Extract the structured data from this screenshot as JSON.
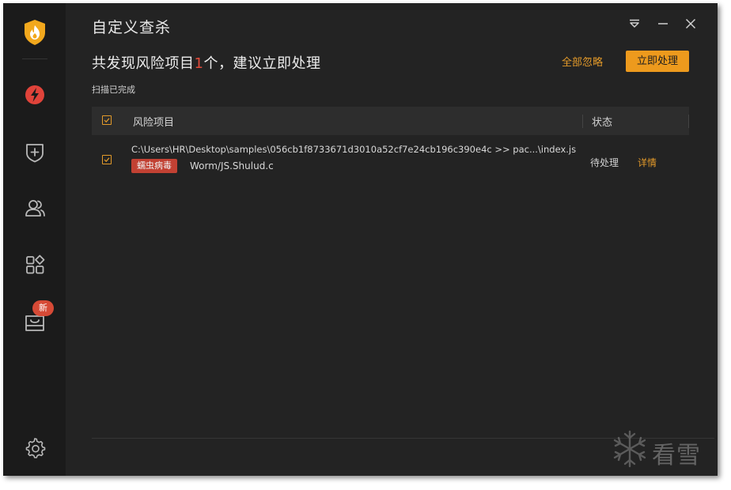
{
  "window": {
    "title": "自定义查杀"
  },
  "sidebar": {
    "items": [
      {
        "name": "lightning-icon"
      },
      {
        "name": "shield-plus-icon"
      },
      {
        "name": "users-icon"
      },
      {
        "name": "apps-icon"
      },
      {
        "name": "toolbox-icon",
        "badge": "新"
      }
    ],
    "settings_icon": "gear-icon"
  },
  "summary": {
    "prefix": "共发现风险项目",
    "count": "1",
    "suffix": "个，建议立即处理",
    "ignore_all": "全部忽略",
    "process_now": "立即处理",
    "scan_status": "扫描已完成"
  },
  "table": {
    "columns": {
      "item": "风险项目",
      "status": "状态"
    },
    "rows": [
      {
        "path": "C:\\Users\\HR\\Desktop\\samples\\056cb1f8733671d3010a52cf7e24cb196c390e4c >> pac...\\index.js",
        "tag": "蠕虫病毒",
        "virus": "Worm/JS.Shulud.c",
        "status": "待处理",
        "detail": "详情"
      }
    ]
  },
  "watermark": {
    "text": "看雪"
  },
  "colors": {
    "accent": "#ed9a1d",
    "danger": "#c24133",
    "count": "#e04a3a",
    "background": "#232323",
    "sidebar": "#1b1b1b"
  }
}
